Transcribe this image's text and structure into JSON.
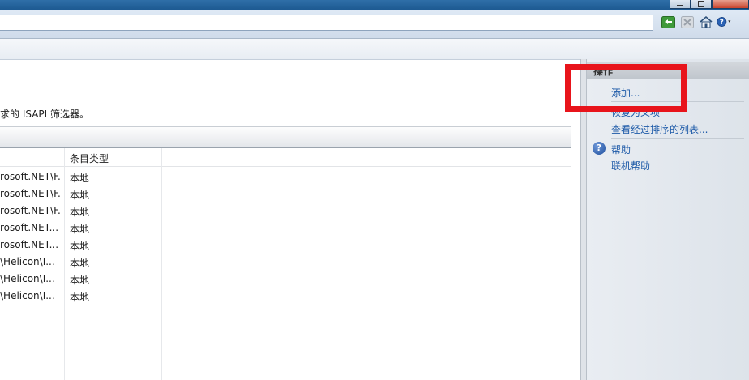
{
  "description": "求的 ISAPI 筛选器。",
  "table": {
    "column_headers": [
      "",
      "条目类型"
    ],
    "rows": [
      {
        "path": "rosoft.NET\\F...",
        "type": "本地"
      },
      {
        "path": "rosoft.NET\\F...",
        "type": "本地"
      },
      {
        "path": "rosoft.NET\\F...",
        "type": "本地"
      },
      {
        "path": "rosoft.NET...",
        "type": "本地"
      },
      {
        "path": "rosoft.NET...",
        "type": "本地"
      },
      {
        "path": "\\Helicon\\I...",
        "type": "本地"
      },
      {
        "path": "\\Helicon\\I...",
        "type": "本地"
      },
      {
        "path": "\\Helicon\\I...",
        "type": "本地"
      }
    ]
  },
  "actions": {
    "header": "操作",
    "add": "添加...",
    "revert": "恢复为父项",
    "view_ordered": "查看经过排序的列表...",
    "help": "帮助",
    "online_help": "联机帮助"
  },
  "toolbar_icons": [
    "refresh-icon",
    "stop-icon",
    "home-icon",
    "help-icon"
  ],
  "colors": {
    "link": "#1d5aa8",
    "highlight_box": "#e8141b",
    "title_bar": "#2f6fa8"
  }
}
